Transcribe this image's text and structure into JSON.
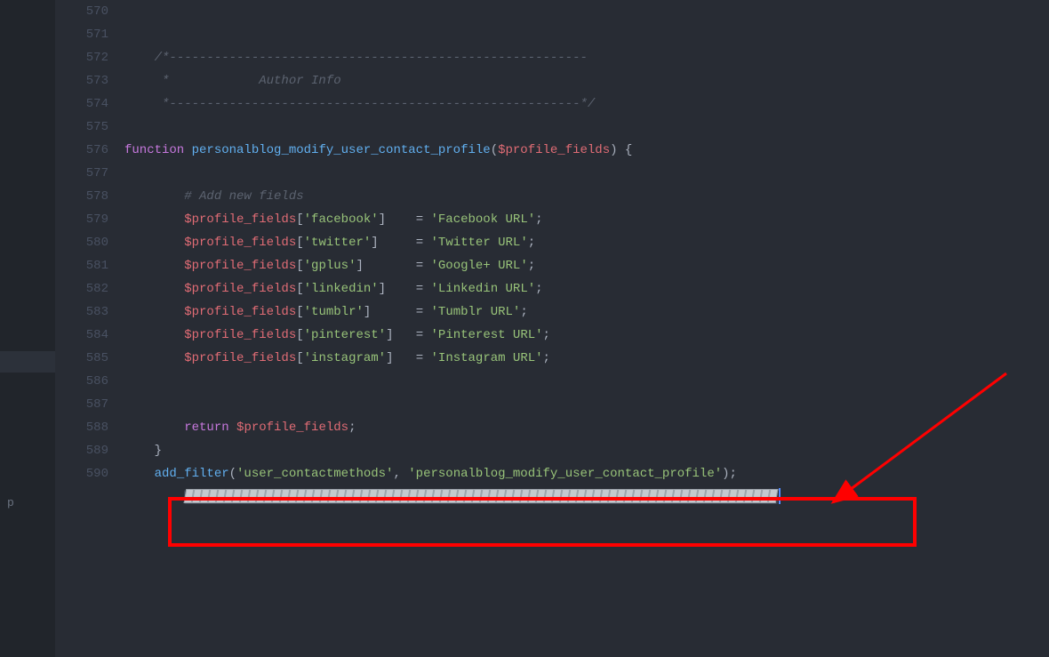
{
  "sidebar": {
    "p_label": "p"
  },
  "lines": [
    {
      "num": "570",
      "tokens": []
    },
    {
      "num": "571",
      "tokens": []
    },
    {
      "num": "572",
      "tokens": [
        {
          "t": "    ",
          "c": ""
        },
        {
          "t": "/*--------------------------------------------------------",
          "c": "tok-comment"
        }
      ]
    },
    {
      "num": "573",
      "tokens": [
        {
          "t": "     *            Author Info",
          "c": "tok-comment"
        }
      ]
    },
    {
      "num": "574",
      "tokens": [
        {
          "t": "     *-------------------------------------------------------*/",
          "c": "tok-comment"
        }
      ]
    },
    {
      "num": "575",
      "tokens": []
    },
    {
      "num": "576",
      "tokens": [
        {
          "t": "function",
          "c": "tok-keyword"
        },
        {
          "t": " ",
          "c": ""
        },
        {
          "t": "personalblog_modify_user_contact_profile",
          "c": "tok-function"
        },
        {
          "t": "(",
          "c": "tok-punct"
        },
        {
          "t": "$profile_fields",
          "c": "tok-variable"
        },
        {
          "t": ")",
          "c": "tok-punct"
        },
        {
          "t": " {",
          "c": "tok-punct"
        }
      ]
    },
    {
      "num": "577",
      "tokens": []
    },
    {
      "num": "578",
      "tokens": [
        {
          "t": "        ",
          "c": ""
        },
        {
          "t": "# Add new fields",
          "c": "tok-comment"
        }
      ]
    },
    {
      "num": "579",
      "tokens": [
        {
          "t": "        ",
          "c": ""
        },
        {
          "t": "$profile_fields",
          "c": "tok-variable"
        },
        {
          "t": "[",
          "c": "tok-punct"
        },
        {
          "t": "'facebook'",
          "c": "tok-string"
        },
        {
          "t": "]",
          "c": "tok-punct"
        },
        {
          "t": "    ",
          "c": ""
        },
        {
          "t": "=",
          "c": "tok-punct"
        },
        {
          "t": " ",
          "c": ""
        },
        {
          "t": "'Facebook URL'",
          "c": "tok-string"
        },
        {
          "t": ";",
          "c": "tok-punct"
        }
      ]
    },
    {
      "num": "580",
      "tokens": [
        {
          "t": "        ",
          "c": ""
        },
        {
          "t": "$profile_fields",
          "c": "tok-variable"
        },
        {
          "t": "[",
          "c": "tok-punct"
        },
        {
          "t": "'twitter'",
          "c": "tok-string"
        },
        {
          "t": "]",
          "c": "tok-punct"
        },
        {
          "t": "     ",
          "c": ""
        },
        {
          "t": "=",
          "c": "tok-punct"
        },
        {
          "t": " ",
          "c": ""
        },
        {
          "t": "'Twitter URL'",
          "c": "tok-string"
        },
        {
          "t": ";",
          "c": "tok-punct"
        }
      ]
    },
    {
      "num": "581",
      "tokens": [
        {
          "t": "        ",
          "c": ""
        },
        {
          "t": "$profile_fields",
          "c": "tok-variable"
        },
        {
          "t": "[",
          "c": "tok-punct"
        },
        {
          "t": "'gplus'",
          "c": "tok-string"
        },
        {
          "t": "]",
          "c": "tok-punct"
        },
        {
          "t": "       ",
          "c": ""
        },
        {
          "t": "=",
          "c": "tok-punct"
        },
        {
          "t": " ",
          "c": ""
        },
        {
          "t": "'Google+ URL'",
          "c": "tok-string"
        },
        {
          "t": ";",
          "c": "tok-punct"
        }
      ]
    },
    {
      "num": "582",
      "tokens": [
        {
          "t": "        ",
          "c": ""
        },
        {
          "t": "$profile_fields",
          "c": "tok-variable"
        },
        {
          "t": "[",
          "c": "tok-punct"
        },
        {
          "t": "'linkedin'",
          "c": "tok-string"
        },
        {
          "t": "]",
          "c": "tok-punct"
        },
        {
          "t": "    ",
          "c": ""
        },
        {
          "t": "=",
          "c": "tok-punct"
        },
        {
          "t": " ",
          "c": ""
        },
        {
          "t": "'Linkedin URL'",
          "c": "tok-string"
        },
        {
          "t": ";",
          "c": "tok-punct"
        }
      ]
    },
    {
      "num": "583",
      "tokens": [
        {
          "t": "        ",
          "c": ""
        },
        {
          "t": "$profile_fields",
          "c": "tok-variable"
        },
        {
          "t": "[",
          "c": "tok-punct"
        },
        {
          "t": "'tumblr'",
          "c": "tok-string"
        },
        {
          "t": "]",
          "c": "tok-punct"
        },
        {
          "t": "      ",
          "c": ""
        },
        {
          "t": "=",
          "c": "tok-punct"
        },
        {
          "t": " ",
          "c": ""
        },
        {
          "t": "'Tumblr URL'",
          "c": "tok-string"
        },
        {
          "t": ";",
          "c": "tok-punct"
        }
      ]
    },
    {
      "num": "584",
      "tokens": [
        {
          "t": "        ",
          "c": ""
        },
        {
          "t": "$profile_fields",
          "c": "tok-variable"
        },
        {
          "t": "[",
          "c": "tok-punct"
        },
        {
          "t": "'pinterest'",
          "c": "tok-string"
        },
        {
          "t": "]",
          "c": "tok-punct"
        },
        {
          "t": "   ",
          "c": ""
        },
        {
          "t": "=",
          "c": "tok-punct"
        },
        {
          "t": " ",
          "c": ""
        },
        {
          "t": "'Pinterest URL'",
          "c": "tok-string"
        },
        {
          "t": ";",
          "c": "tok-punct"
        }
      ]
    },
    {
      "num": "585",
      "tokens": [
        {
          "t": "        ",
          "c": ""
        },
        {
          "t": "$profile_fields",
          "c": "tok-variable"
        },
        {
          "t": "[",
          "c": "tok-punct"
        },
        {
          "t": "'instagram'",
          "c": "tok-string"
        },
        {
          "t": "]",
          "c": "tok-punct"
        },
        {
          "t": "   ",
          "c": ""
        },
        {
          "t": "=",
          "c": "tok-punct"
        },
        {
          "t": " ",
          "c": ""
        },
        {
          "t": "'Instagram URL'",
          "c": "tok-string"
        },
        {
          "t": ";",
          "c": "tok-punct"
        }
      ]
    },
    {
      "num": "586",
      "tokens": []
    },
    {
      "num": "587",
      "tokens": []
    },
    {
      "num": "588",
      "tokens": [
        {
          "t": "        ",
          "c": ""
        },
        {
          "t": "return",
          "c": "tok-keyword"
        },
        {
          "t": " ",
          "c": ""
        },
        {
          "t": "$profile_fields",
          "c": "tok-variable"
        },
        {
          "t": ";",
          "c": "tok-punct"
        }
      ]
    },
    {
      "num": "589",
      "tokens": [
        {
          "t": "    }",
          "c": "tok-punct"
        }
      ]
    },
    {
      "num": "590",
      "tokens": [
        {
          "t": "    ",
          "c": ""
        },
        {
          "t": "add_filter",
          "c": "tok-function"
        },
        {
          "t": "(",
          "c": "tok-punct"
        },
        {
          "t": "'user_contactmethods'",
          "c": "tok-string"
        },
        {
          "t": ",",
          "c": "tok-punct"
        },
        {
          "t": " ",
          "c": ""
        },
        {
          "t": "'personalblog_modify_user_contact_profile'",
          "c": "tok-string"
        },
        {
          "t": ")",
          "c": "tok-punct"
        },
        {
          "t": ";",
          "c": "tok-punct"
        }
      ]
    }
  ],
  "glyph_count": 74,
  "annotation": {
    "color": "#ff0000"
  }
}
